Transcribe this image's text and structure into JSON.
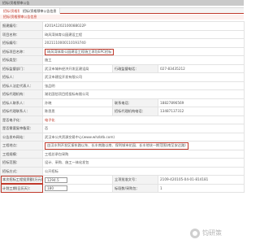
{
  "window": {
    "title": "招标/资格预审公告"
  },
  "tabs": [
    {
      "label": "招标/资格预审公告"
    },
    {
      "label": "招标/资格预审公告信息"
    }
  ],
  "section_title": "招标/资格预审公告信息",
  "rows": {
    "notice_no": {
      "label": "报建编号：",
      "value": "4201A1202100088022P"
    },
    "project_name": {
      "label": "项目名称：",
      "value": "琦风湾体育公园建设工程"
    },
    "bid_no": {
      "label": "招标编号：",
      "value": "2021110000110193740"
    },
    "bid_project_name": {
      "label": "招标项目名称：",
      "value": "琦风湾体育公园建设工程施工承包EPC招标"
    },
    "bid_type": {
      "label": "招标类型：",
      "value": "施工"
    },
    "supervisor": {
      "label": "招标监督部门：",
      "value": "武汉市城市经济开发区建设局",
      "label2": "行政监督电话：",
      "value2": "027-83435212"
    },
    "tenderer": {
      "label": "招标人：",
      "value": "武汉市建设开发有限公司"
    },
    "legal_rep": {
      "label": "招标人法定代表人：",
      "value": "张品明"
    },
    "agency": {
      "label": "招标代理机构：",
      "value": "湖北国信项目招投标有限公司"
    },
    "contact": {
      "label": "招标人联系人：",
      "value": "孙晓",
      "label2": "联系电话：",
      "value2": "18827896569"
    },
    "agency_contact": {
      "label": "招标代理联系人：",
      "value": "陈思思",
      "label2": "招标代理机构电话：",
      "value2": "13487137312"
    },
    "open_method": {
      "label": "是否电子化：",
      "value": "电子化"
    },
    "region": {
      "label": "是否需要复审备案：",
      "value": "否"
    },
    "website": {
      "label": "公告发布网站：",
      "value": "武汉市公共资源交易中心(www.whzbtb.com)"
    },
    "location": {
      "label": "工程地点：",
      "value": "由汉水到开发区振东路以东、长丰南路以南、保利城市花园、长丰地块一期范围(南至安达路)"
    },
    "scale": {
      "label": "工程规模：",
      "value": "工程总承包采购"
    },
    "scope": {
      "label": "招标范围：",
      "value": "设计、采购、施工一体化发包"
    },
    "method": {
      "label": "招标方式：",
      "value": "公开招标"
    },
    "estimate": {
      "label": "本次招标工程投资额(万元)：",
      "value": "1294.5",
      "label2": "立项批准文号：",
      "value2": "2109-420105-04-01-814181"
    },
    "duration": {
      "label": "计划工期(日历天)：",
      "value": "180",
      "label2": "标段数/采购包：",
      "value2": "1"
    }
  },
  "watermark": {
    "text": "钧研策"
  },
  "colors": {
    "accent": "#c0392b",
    "link": "#4a76b8",
    "label_bg": "#f3f3f3",
    "border": "#e3e3e3"
  }
}
